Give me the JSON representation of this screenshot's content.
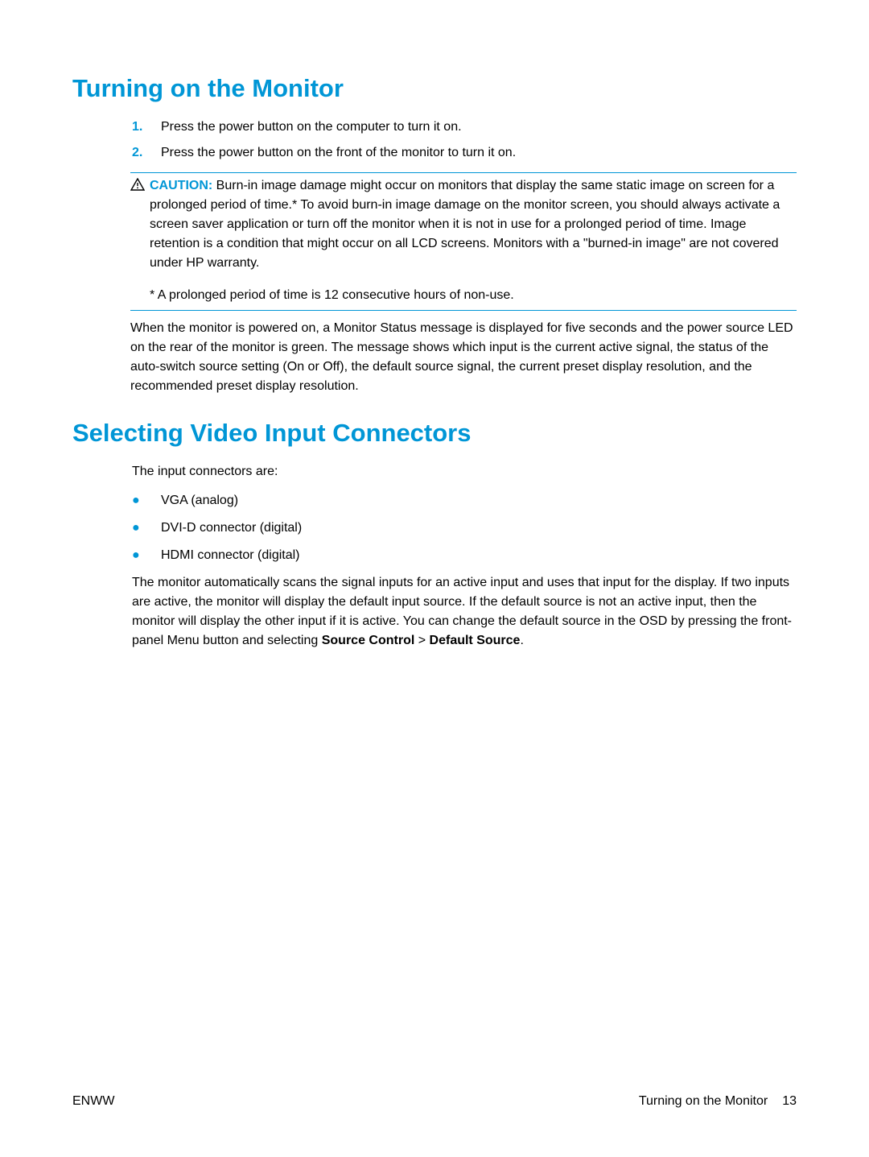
{
  "section1": {
    "heading": "Turning on the Monitor",
    "steps": [
      {
        "num": "1.",
        "text": "Press the power button on the computer to turn it on."
      },
      {
        "num": "2.",
        "text": "Press the power button on the front of the monitor to turn it on."
      }
    ],
    "caution_label": "CAUTION:",
    "caution_text": "Burn-in image damage might occur on monitors that display the same static image on screen for a prolonged period of time.* To avoid burn-in image damage on the monitor screen, you should always activate a screen saver application or turn off the monitor when it is not in use for a prolonged period of time. Image retention is a condition that might occur on all LCD screens. Monitors with a \"burned-in image\" are not covered under HP warranty.",
    "caution_footnote": "* A prolonged period of time is 12 consecutive hours of non-use.",
    "post_caution": "When the monitor is powered on, a Monitor Status message is displayed for five seconds and the power source LED on the rear of the monitor is green. The message shows which input is the current active signal, the status of the auto-switch source setting (On or Off), the default source signal, the current preset display resolution, and the recommended preset display resolution."
  },
  "section2": {
    "heading": "Selecting Video Input Connectors",
    "intro": "The input connectors are:",
    "bullets": [
      "VGA (analog)",
      "DVI-D connector (digital)",
      "HDMI connector (digital)"
    ],
    "body_start": "The monitor automatically scans the signal inputs for an active input and uses that input for the display. If two inputs are active, the monitor will display the default input source. If the default source is not an active input, then the monitor will display the other input if it is active. You can change the default source in the OSD by pressing the front-panel Menu button and selecting ",
    "body_bold1": "Source Control",
    "body_gt": " > ",
    "body_bold2": "Default Source",
    "body_end": "."
  },
  "footer": {
    "left": "ENWW",
    "right_text": "Turning on the Monitor",
    "page_num": "13"
  }
}
